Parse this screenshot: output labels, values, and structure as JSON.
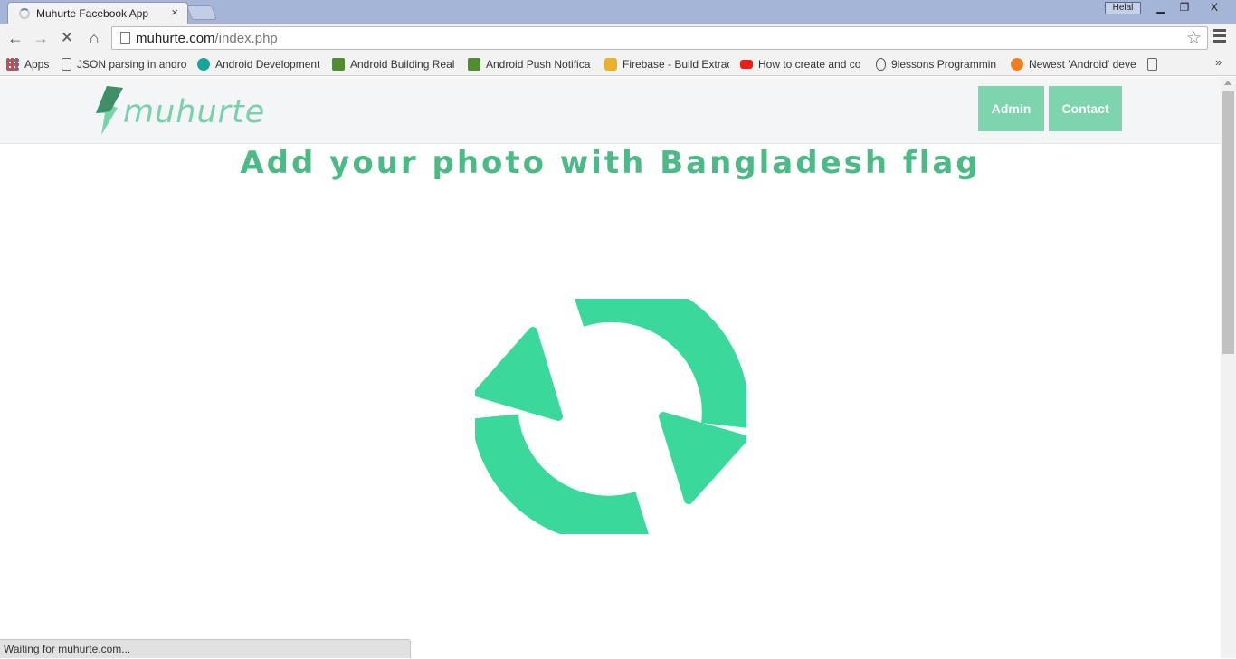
{
  "browser": {
    "tab_title": "Muhurte Facebook App",
    "tab_close": "×",
    "user_name": "Helal",
    "window_controls": {
      "minimize": "▁",
      "maximize": "❐",
      "close": "X"
    },
    "nav": {
      "back": "←",
      "forward": "→",
      "stop": "✕",
      "home": "⌂"
    },
    "url_domain": "muhurte.com",
    "url_path": "/index.php",
    "star": "☆",
    "bookmarks": [
      {
        "label": "Apps",
        "icon": "apps-grid-icon",
        "color": "#e0453a"
      },
      {
        "label": "JSON parsing in andro",
        "icon": "page-icon",
        "color": "#ffffff"
      },
      {
        "label": "Android Development",
        "icon": "vogella-icon",
        "color": "#18a69a"
      },
      {
        "label": "Android Building Real",
        "icon": "android-icon",
        "color": "#4f8d2f"
      },
      {
        "label": "Android Push Notifica",
        "icon": "android-icon",
        "color": "#4f8d2f"
      },
      {
        "label": "Firebase - Build Extrac",
        "icon": "firebase-icon",
        "color": "#e8b22b"
      },
      {
        "label": "How to create and co",
        "icon": "youtube-icon",
        "color": "#e62117"
      },
      {
        "label": "9lessons Programmin",
        "icon": "egg-icon",
        "color": "#ffffff"
      },
      {
        "label": "Newest 'Android' deve",
        "icon": "fn-icon",
        "color": "#f07d1e"
      },
      {
        "label": "",
        "icon": "page-icon",
        "color": "#ffffff"
      }
    ],
    "more": "»",
    "status": "Waiting for muhurte.com..."
  },
  "site": {
    "logo_text": "muhurte",
    "nav": {
      "admin": "Admin",
      "contact": "Contact"
    },
    "headline": "Add your photo with Bangladesh flag",
    "colors": {
      "accent": "#3ad99b",
      "nav_button": "#7dd4ad",
      "headline": "#4cba86"
    }
  }
}
